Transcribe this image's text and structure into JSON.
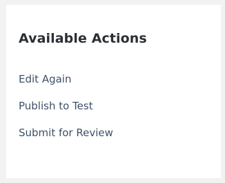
{
  "panel": {
    "title": "Available Actions",
    "actions": [
      {
        "label": "Edit Again"
      },
      {
        "label": "Publish to Test"
      },
      {
        "label": "Submit for Review"
      }
    ]
  }
}
